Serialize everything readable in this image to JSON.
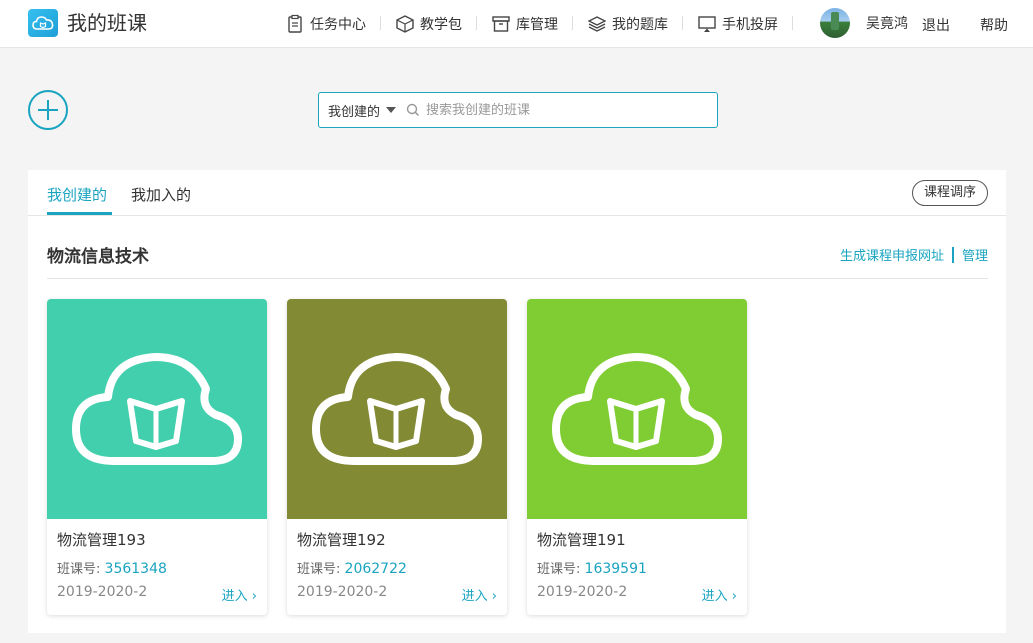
{
  "header": {
    "title": "我的班课",
    "nav": [
      {
        "label": "任务中心",
        "icon": "clipboard-icon"
      },
      {
        "label": "教学包",
        "icon": "package-icon"
      },
      {
        "label": "库管理",
        "icon": "archive-icon"
      },
      {
        "label": "我的题库",
        "icon": "layers-icon"
      },
      {
        "label": "手机投屏",
        "icon": "screen-cast-icon"
      }
    ],
    "user_name": "吴竟鸿",
    "logout_label": "退出",
    "help_label": "帮助"
  },
  "search": {
    "scope_label": "我创建的",
    "placeholder": "搜索我创建的班课"
  },
  "tabs": {
    "created_label": "我创建的",
    "joined_label": "我加入的",
    "order_button_label": "课程调序"
  },
  "section": {
    "title": "物流信息技术",
    "generate_link_label": "生成课程申报网址",
    "manage_label": "管理"
  },
  "courses": [
    {
      "name": "物流管理193",
      "code_label": "班课号:",
      "code": "3561348",
      "term": "2019-2020-2",
      "enter_label": "进入",
      "cover_color": "#41cfad"
    },
    {
      "name": "物流管理192",
      "code_label": "班课号:",
      "code": "2062722",
      "term": "2019-2020-2",
      "enter_label": "进入",
      "cover_color": "#828a34"
    },
    {
      "name": "物流管理191",
      "code_label": "班课号:",
      "code": "1639591",
      "term": "2019-2020-2",
      "enter_label": "进入",
      "cover_color": "#7fcd32"
    }
  ],
  "colors": {
    "accent": "#1aa4c0"
  }
}
